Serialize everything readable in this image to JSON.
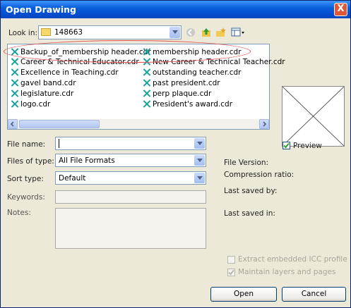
{
  "window": {
    "title": "Open Drawing",
    "close_glyph": "X"
  },
  "lookin": {
    "label": "Look in:",
    "value": "148663"
  },
  "files": [
    "Backup_of_membership header.cdr",
    "Career & Technical Educator.cdr",
    "Excellence in Teaching.cdr",
    "gavel band.cdr",
    "legislature.cdr",
    "logo.cdr",
    "membership header.cdr",
    "New Career & Technical Teacher.cdr",
    "outstanding teacher.cdr",
    "past president.cdr",
    "perp plaque.cdr",
    "President's award.cdr"
  ],
  "form": {
    "filename_label": "File name:",
    "filename_value": "",
    "filetype_label": "Files of type:",
    "filetype_value": "All File Formats",
    "sorttype_label": "Sort type:",
    "sorttype_value": "Default",
    "keywords_label": "Keywords:",
    "notes_label": "Notes:"
  },
  "info": {
    "preview_label": "Preview",
    "file_version_label": "File Version:",
    "compression_label": "Compression ratio:",
    "last_saved_by_label": "Last saved by:",
    "last_saved_in_label": "Last saved in:",
    "extract_icc_label": "Extract embedded ICC profile",
    "maintain_layers_label": "Maintain layers and pages"
  },
  "buttons": {
    "open": "Open",
    "cancel": "Cancel"
  },
  "colors": {
    "titlebar": "#0a5fdb",
    "annotation": "#e05050",
    "file_icon": "#18a09a"
  }
}
